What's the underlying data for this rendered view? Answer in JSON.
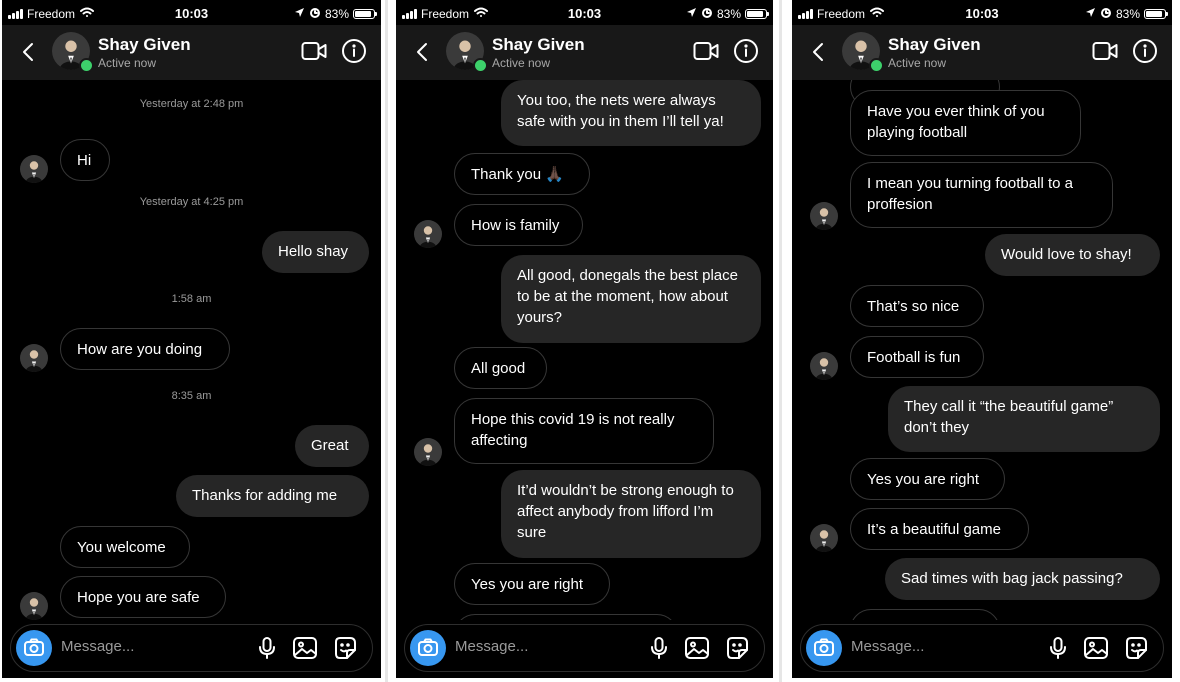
{
  "status_bar": {
    "carrier": "Freedom",
    "time": "10:03",
    "battery": "83%"
  },
  "contact": {
    "name": "Shay Given",
    "status": "Active now"
  },
  "composer": {
    "placeholder": "Message..."
  },
  "icons": {
    "back": "chevron-left-icon",
    "video": "video-camera-icon",
    "info": "info-circle-icon",
    "camera": "camera-icon",
    "mic": "microphone-icon",
    "gallery": "image-icon",
    "sticker": "sticker-icon",
    "signal": "signal-bars-icon",
    "wifi": "wifi-icon",
    "battery": "battery-icon"
  },
  "colors": {
    "background": "#000000",
    "header": "#181818",
    "outgoing_bubble": "#262626",
    "incoming_border": "#363636",
    "online": "#3dd16b",
    "camera_button": "#3797f0"
  },
  "panels": [
    {
      "items": [
        {
          "type": "timestamp",
          "text": "Yesterday at 2:48 pm"
        },
        {
          "type": "in",
          "text": "Hi",
          "avatar": true
        },
        {
          "type": "timestamp",
          "text": "Yesterday at 4:25 pm"
        },
        {
          "type": "out",
          "text": "Hello shay"
        },
        {
          "type": "timestamp",
          "text": "1:58 am"
        },
        {
          "type": "in",
          "text": "How are you doing",
          "avatar": true
        },
        {
          "type": "timestamp",
          "text": "8:35 am"
        },
        {
          "type": "out",
          "text": "Great"
        },
        {
          "type": "out",
          "text": "Thanks for adding me"
        },
        {
          "type": "in",
          "text": "You welcome"
        },
        {
          "type": "in",
          "text": "Hope you are safe",
          "avatar": true
        }
      ]
    },
    {
      "items": [
        {
          "type": "out",
          "text": "You too, the nets were always safe with you in them I’ll tell ya!"
        },
        {
          "type": "in",
          "text": "Thank you 🙏🏿"
        },
        {
          "type": "in",
          "text": "How is family",
          "avatar": true
        },
        {
          "type": "out",
          "text": "All good, donegals the best place to be at the moment, how about yours?"
        },
        {
          "type": "in",
          "text": "All good"
        },
        {
          "type": "in",
          "text": "Hope this covid 19 is not really affecting",
          "avatar": true
        },
        {
          "type": "out",
          "text": "It’d wouldn’t be strong enough to affect anybody from lifford I’m sure"
        },
        {
          "type": "in",
          "text": "Yes you are right"
        }
      ]
    },
    {
      "items": [
        {
          "type": "in",
          "text": "Have you ever think of you playing football"
        },
        {
          "type": "in",
          "text": "I mean you turning football to a proffesion",
          "avatar": true
        },
        {
          "type": "out",
          "text": "Would love to shay!"
        },
        {
          "type": "in",
          "text": "That’s so nice"
        },
        {
          "type": "in",
          "text": "Football is fun",
          "avatar": true
        },
        {
          "type": "out",
          "text": "They call it “the beautiful game” don’t they"
        },
        {
          "type": "in",
          "text": "Yes you are right"
        },
        {
          "type": "in",
          "text": "It’s a beautiful game",
          "avatar": true
        },
        {
          "type": "out",
          "text": "Sad times with bag jack passing?"
        }
      ]
    }
  ]
}
